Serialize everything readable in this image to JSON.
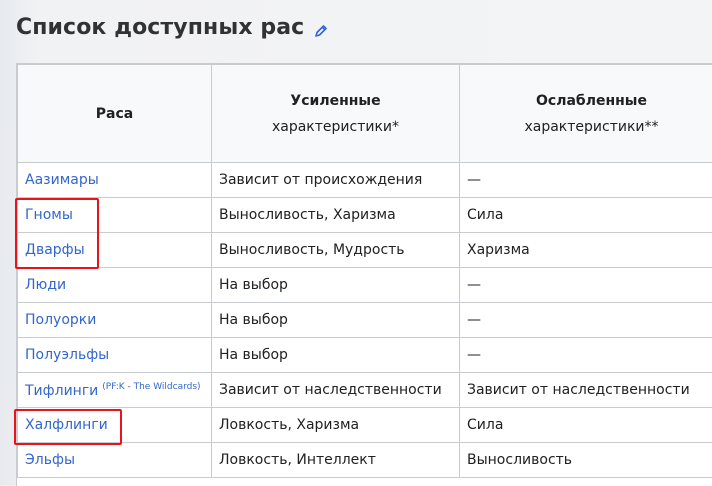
{
  "section": {
    "title": "Список доступных рас"
  },
  "table": {
    "headers": {
      "race": "Раса",
      "plus_bold": "Усиленные",
      "plus_normal": "характеристики*",
      "minus_bold": "Ослабленные",
      "minus_normal": "характеристики**"
    },
    "rows": [
      {
        "race": "Аазимары",
        "sup": "",
        "plus": "Зависит от происхождения",
        "minus": "—"
      },
      {
        "race": "Гномы",
        "sup": "",
        "plus": "Выносливость, Харизма",
        "minus": "Сила"
      },
      {
        "race": "Дварфы",
        "sup": "",
        "plus": "Выносливость, Мудрость",
        "minus": "Харизма"
      },
      {
        "race": "Люди",
        "sup": "",
        "plus": "На выбор",
        "minus": "—"
      },
      {
        "race": "Полуорки",
        "sup": "",
        "plus": "На выбор",
        "minus": "—"
      },
      {
        "race": "Полуэльфы",
        "sup": "",
        "plus": "На выбор",
        "minus": "—"
      },
      {
        "race": "Тифлинги",
        "sup": "(PF:K - The Wildcards)",
        "plus": "Зависит от наследственности",
        "minus": "Зависит от наследственности"
      },
      {
        "race": "Халфлинги",
        "sup": "",
        "plus": "Ловкость, Харизма",
        "minus": "Сила"
      },
      {
        "race": "Эльфы",
        "sup": "",
        "plus": "Ловкость, Интеллект",
        "minus": "Выносливость"
      }
    ]
  },
  "highlight_color": "#e8141b",
  "link_color": "#3366cc",
  "icons": {
    "edit": "pencil-edit-icon"
  }
}
